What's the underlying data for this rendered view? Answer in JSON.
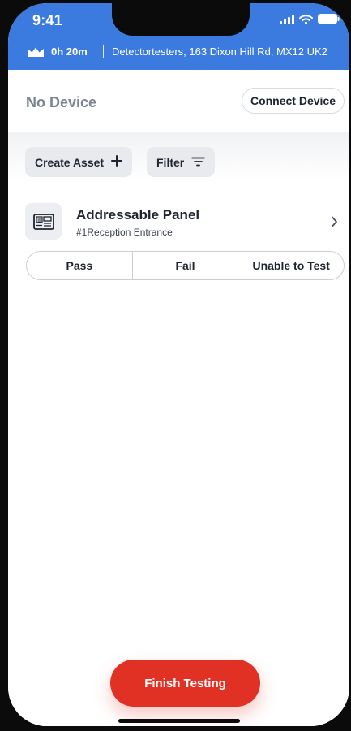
{
  "status_bar": {
    "time": "9:41",
    "icons": [
      "signal-icon",
      "wifi-icon",
      "battery-icon"
    ]
  },
  "job": {
    "icon": "crown-icon",
    "duration": "0h 20m",
    "address": "Detectortesters, 163 Dixon Hill Rd, MX12 UK2"
  },
  "device": {
    "status": "No Device",
    "connect_label": "Connect Device"
  },
  "toolbar": {
    "create_label": "Create Asset",
    "create_icon": "plus-icon",
    "filter_label": "Filter",
    "filter_icon": "filter-icon"
  },
  "assets": [
    {
      "icon": "panel-icon",
      "title": "Addressable Panel",
      "subtitle": "#1Reception Entrance",
      "actions": [
        "Pass",
        "Fail",
        "Unable to Test"
      ]
    }
  ],
  "footer": {
    "finish_label": "Finish Testing"
  },
  "colors": {
    "header_blue": "#3b7be0",
    "finish_red": "#e03124",
    "chip_gray": "#e8eaed",
    "muted_text": "#7b8494"
  }
}
